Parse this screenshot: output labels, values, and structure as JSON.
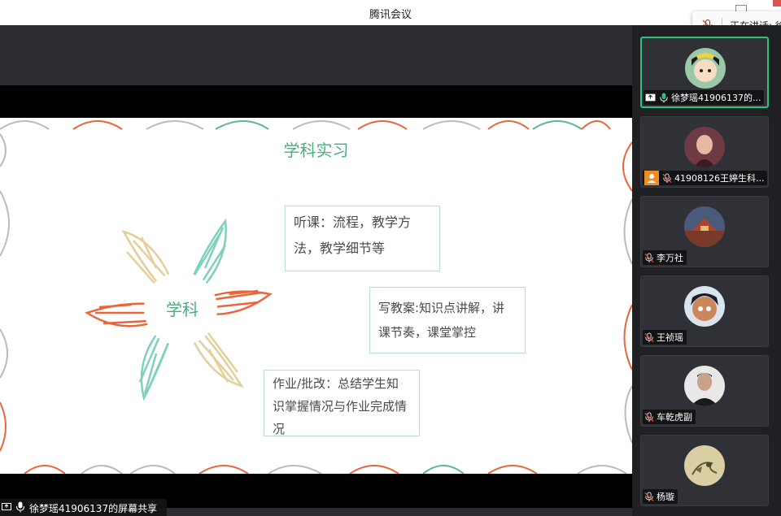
{
  "window": {
    "title": "腾讯会议"
  },
  "speaking": {
    "label": "正在讲话: 徐"
  },
  "slide": {
    "title": "学科实习",
    "center": "学科",
    "box1": "听课：流程，教学方法，教学细节等",
    "box2": "写教案:知识点讲解，讲课节奏，课堂掌控",
    "box3": "作业/批改：总结学生知识掌握情况与作业完成情况"
  },
  "share": {
    "label": "徐梦瑶41906137的屏幕共享"
  },
  "participants": [
    {
      "name": "徐梦瑶41906137的...",
      "mic": "on",
      "icon": "screen-share-icon"
    },
    {
      "name": "41908126王婷生科...",
      "mic": "muted",
      "icon": "user-badge-icon"
    },
    {
      "name": "李万社",
      "mic": "muted"
    },
    {
      "name": "王祯瑶",
      "mic": "muted"
    },
    {
      "name": "车乾虎副",
      "mic": "muted"
    },
    {
      "name": "杨璇",
      "mic": "muted"
    }
  ],
  "colors": {
    "accent_green": "#48b07a",
    "active_border": "#2ec27e",
    "leaf_orange": "#e8663a",
    "leaf_teal": "#7fd0bd",
    "leaf_beige": "#e3cf9a"
  }
}
